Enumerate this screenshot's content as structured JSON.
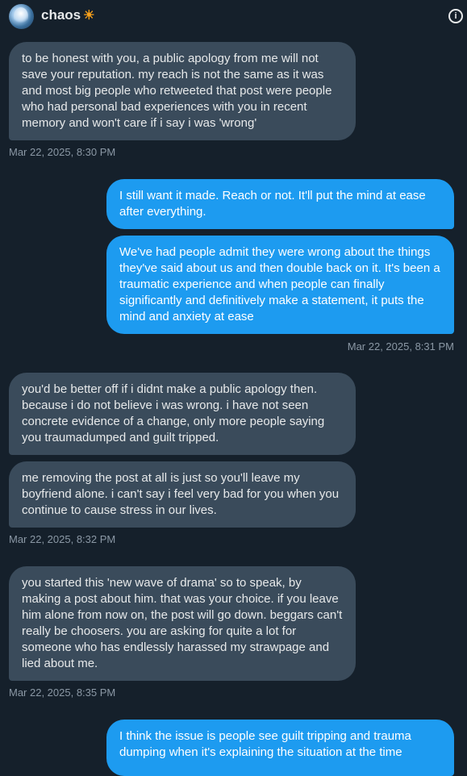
{
  "header": {
    "name": "chaos",
    "emoji": "☀",
    "info_icon": "info-icon"
  },
  "messages": [
    {
      "text": "to be honest with you, a public apology from me will not save your reputation. my reach is not the same as it was and most big people who retweeted that post were people who had personal bad experiences with you in recent memory and won't care if i say i was 'wrong'"
    },
    {
      "text": "I still want it made. Reach or not. It'll put the mind at ease after everything."
    },
    {
      "text": "We've had people admit they were wrong about the things they've said about us and then double back on it. It's been a traumatic experience and when people can finally significantly and definitively make a statement, it puts the mind and anxiety at ease"
    },
    {
      "text": "you'd be better off if i didnt make a public apology then. because i do not believe i was wrong. i have not seen concrete evidence of a change, only more people saying you traumadumped and guilt tripped."
    },
    {
      "text": "me removing the post at all is just so you'll leave my boyfriend alone. i can't say i feel very bad for you when you continue to cause stress in our lives."
    },
    {
      "text": "you started this 'new wave of drama' so to speak, by making a post about him. that was your choice. if you leave him alone from now on, the post will go down. beggars can't really be choosers. you are asking for quite a lot for someone who has endlessly harassed my strawpage and lied about me."
    },
    {
      "text": "I think the issue is people see guilt tripping and trauma dumping when it's explaining the situation at the time"
    }
  ],
  "timestamps": [
    "Mar 22, 2025, 8:30 PM",
    "Mar 22, 2025, 8:31 PM",
    "Mar 22, 2025, 8:32 PM",
    "Mar 22, 2025, 8:35 PM"
  ]
}
